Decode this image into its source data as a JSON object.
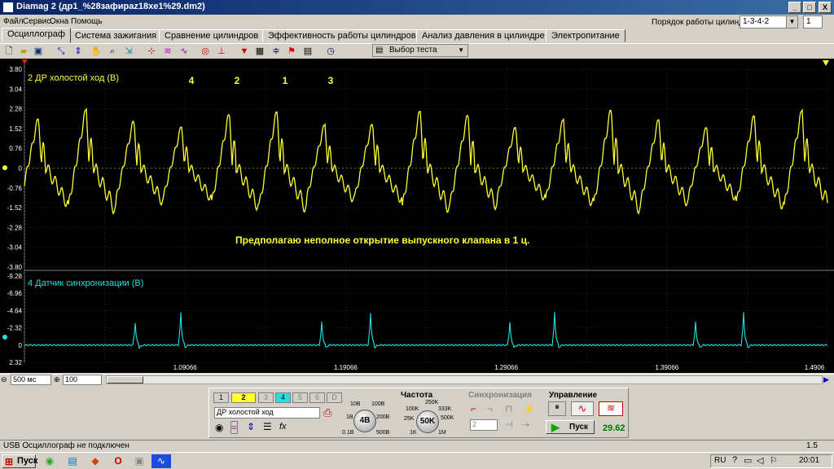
{
  "window": {
    "title": "Diamag 2 (дp1_%28зaфиpaz18xe1%29.dm2)",
    "min": "_",
    "max": "□",
    "close": "X"
  },
  "menu": [
    "Файл",
    "Сервис",
    "Окна",
    "Помощь"
  ],
  "cylinder_order": {
    "label": "Порядок работы цилиндров",
    "value": "1-3-4-2",
    "index": "1"
  },
  "tabs": [
    "Осциллограф",
    "Система зажигания",
    "Сравнение цилиндров",
    "Эффективность работы цилиндров",
    "Анализ давления в цилиндре",
    "Электропитание"
  ],
  "active_tab": "Осциллограф",
  "toolbar": {
    "test_select": "Выбор теста"
  },
  "scope": {
    "ch2_title": "2 ДР холостой ход (В)",
    "ch4_title": "4 Датчик синхронизации (В)",
    "annotation": "Предполагаю неполное открытие выпускного клапана в 1 ц.",
    "cyl_markers": [
      "4",
      "2",
      "1",
      "3"
    ],
    "ch2_ticks": [
      "3.80",
      "3.04",
      "2.28",
      "1.52",
      "0.76",
      "0",
      "-0.76",
      "-1.52",
      "-2.28",
      "-3.04",
      "-3.80"
    ],
    "ch4_ticks": [
      "-9.28",
      "-6.96",
      "-4.64",
      "-2.32",
      "0",
      "2.32"
    ],
    "time_ticks": [
      "1.09066",
      "1.19066",
      "1.29066",
      "1.39066",
      "1.4906"
    ],
    "ch2_color": "#ffff33",
    "ch4_color": "#22e0e0"
  },
  "hbar": {
    "timebase": "500 мс",
    "zoom": "100"
  },
  "channels": [
    "1",
    "2",
    "3",
    "4",
    "5",
    "6",
    "D"
  ],
  "channel_name": "ДР холостой ход",
  "gain": {
    "labels": [
      "10В",
      "100В",
      "1В",
      "200В",
      "0.1В",
      "500В"
    ],
    "value": "4В"
  },
  "freq": {
    "title": "Частота",
    "labels": [
      "250K",
      "100K",
      "333K",
      "25K",
      "500K",
      "1K",
      "1M"
    ],
    "value": "50K"
  },
  "sync": {
    "title": "Синхронизация",
    "channel": "2"
  },
  "control": {
    "title": "Управление",
    "start": "Пуск",
    "fps": "29.62"
  },
  "status": {
    "text": "USB Осциллограф не подключен",
    "right": "1.5"
  },
  "taskbar": {
    "start": "Пуск",
    "lang": "RU",
    "clock": "20:01"
  }
}
